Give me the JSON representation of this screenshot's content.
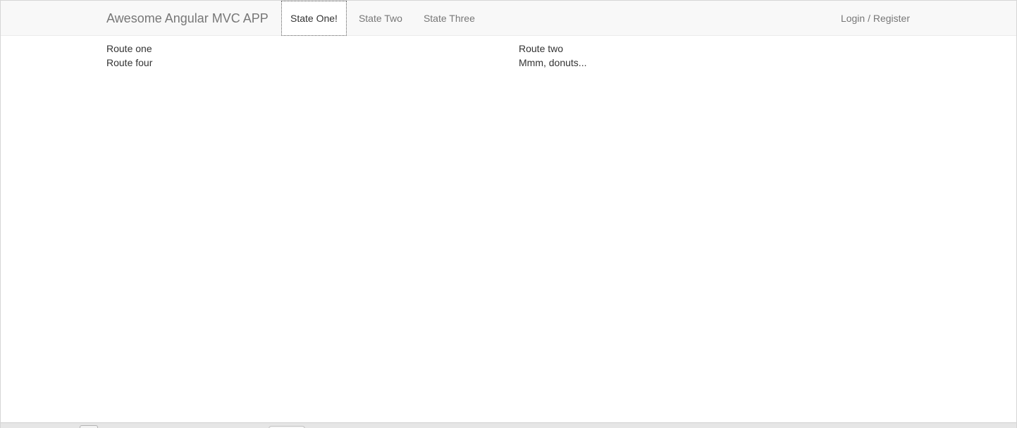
{
  "navbar": {
    "brand": "Awesome Angular MVC APP",
    "tabs": [
      {
        "label": "State One!",
        "active": true
      },
      {
        "label": "State Two",
        "active": false
      },
      {
        "label": "State Three",
        "active": false
      }
    ],
    "login_label": "Login / Register"
  },
  "content": {
    "items": [
      "Route one",
      "Route two",
      "Route four",
      "Mmm, donuts..."
    ]
  },
  "colors": {
    "navbar_bg": "#f8f8f8",
    "nav_text": "#777777",
    "active_text": "#333333"
  }
}
